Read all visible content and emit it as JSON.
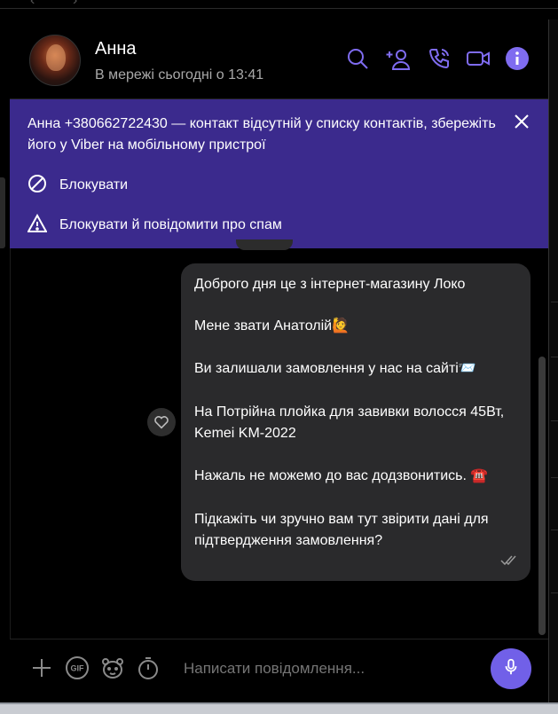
{
  "header": {
    "contact_name": "Анна",
    "status": "В мережі сьогодні о 13:41",
    "icons": [
      "search-icon",
      "add-participant-icon",
      "call-icon",
      "video-call-icon",
      "info-icon"
    ]
  },
  "banner": {
    "message": "Анна +380662722430 — контакт відсутній у списку контактів, збережіть його у Viber на мобільному пристрої",
    "block_label": "Блокувати",
    "block_spam_label": "Блокувати й повідомити про спам"
  },
  "message": {
    "lines": [
      "Доброго дня це з інтернет-магазину Локо",
      "Мене звати Анатолій🙋",
      "Ви залишали замовлення у нас на сайті📨",
      "На  Потрійна плойка для завивки волосся 45Вт, Kemei KM-2022",
      "Нажаль не можемо до вас додзвонитись. ☎️",
      "Підкажіть чи зручно вам тут звірити дані для підтвердження замовлення?"
    ]
  },
  "composer": {
    "placeholder": "Написати повідомлення..."
  },
  "colors": {
    "accent": "#7160e8",
    "banner_bg": "#3b2a8d",
    "bubble_bg": "#2a2a2c"
  }
}
